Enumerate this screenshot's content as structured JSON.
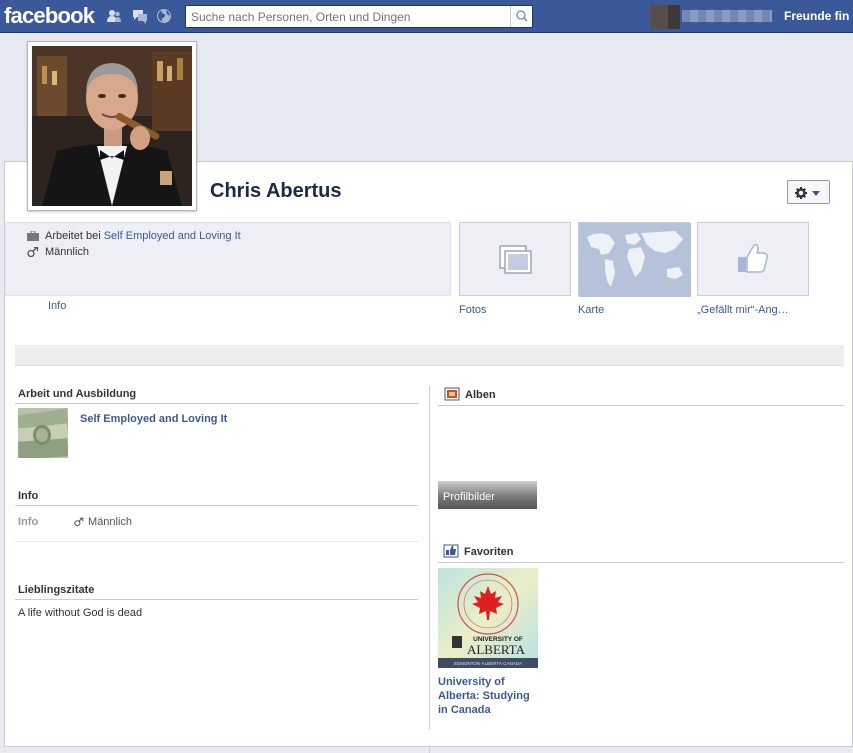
{
  "header": {
    "logo": "facebook",
    "search_placeholder": "Suche nach Personen, Orten und Dingen",
    "friends_link": "Freunde fin"
  },
  "profile": {
    "name": "Chris Abertus",
    "works_prefix": "Arbeitet bei",
    "employer": "Self Employed and Loving It",
    "gender": "Männlich",
    "info_link": "Info"
  },
  "tiles": [
    {
      "label": "Fotos",
      "icon": "photos-icon"
    },
    {
      "label": "Karte",
      "icon": "map-icon"
    },
    {
      "label": "„Gefällt mir“-Ang…",
      "icon": "like-icon"
    }
  ],
  "left": {
    "work_heading": "Arbeit und Ausbildung",
    "work_employer": "Self Employed and Loving It",
    "info_heading": "Info",
    "info_label": "Info",
    "info_value": "Männlich",
    "quotes_heading": "Lieblingszitate",
    "quote": "A life without God is dead"
  },
  "right": {
    "albums_heading": "Alben",
    "album_label": "Profilbilder",
    "favorites_heading": "Favoriten",
    "favorite_title": "University of Alberta: Studying in Canada",
    "favorite_logo_text": "UNIVERSITY OF",
    "favorite_logo_name": "ALBERTA",
    "favorite_logo_sub": "EDMONTON·ALBERTA·CANADA"
  },
  "colors": {
    "brand": "#3b5998",
    "link": "#3b5998"
  }
}
